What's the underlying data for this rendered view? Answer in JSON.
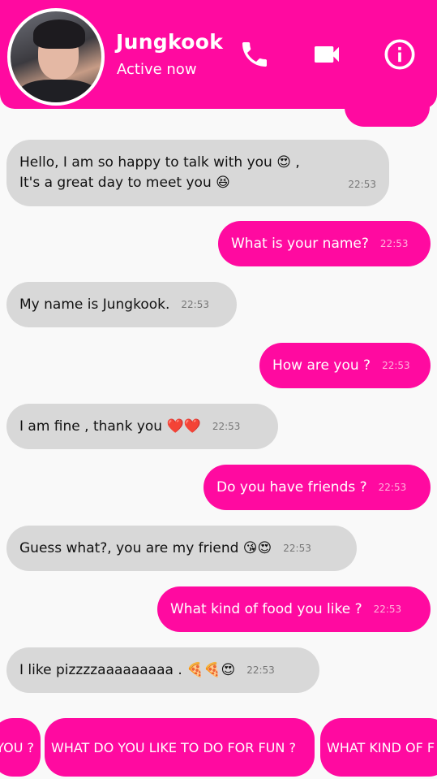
{
  "header": {
    "name": "Jungkook",
    "status": "Active now",
    "icons": [
      "phone-icon",
      "video-camera-icon",
      "info-icon"
    ]
  },
  "colors": {
    "accent": "#ff0aa0",
    "received_bubble": "#d8d8d8",
    "background": "#f9f9f9"
  },
  "messages": [
    {
      "side": "received",
      "lines": [
        "Hello, I am so happy to talk with you 😍 ,",
        "It's a great day to meet you 😆"
      ],
      "time": "22:53"
    },
    {
      "side": "sent",
      "text": "What is your name?",
      "time": "22:53"
    },
    {
      "side": "received",
      "text": "My name is Jungkook.",
      "time": "22:53"
    },
    {
      "side": "sent",
      "text": "How are you ?",
      "time": "22:53"
    },
    {
      "side": "received",
      "text": "I am fine , thank you ❤️❤️",
      "time": "22:53"
    },
    {
      "side": "sent",
      "text": "Do you have friends ?",
      "time": "22:53"
    },
    {
      "side": "received",
      "text": "Guess what?, you are my friend 😘😍",
      "time": "22:53"
    },
    {
      "side": "sent",
      "text": "What kind of food you like ?",
      "time": "22:53"
    },
    {
      "side": "received",
      "text": "I like pizzzzaaaaaaaaa . 🍕🍕😍",
      "time": "22:53"
    }
  ],
  "quick_replies": [
    "YOU ?",
    "WHAT DO YOU LIKE TO DO FOR FUN ?",
    "WHAT KIND OF F"
  ]
}
